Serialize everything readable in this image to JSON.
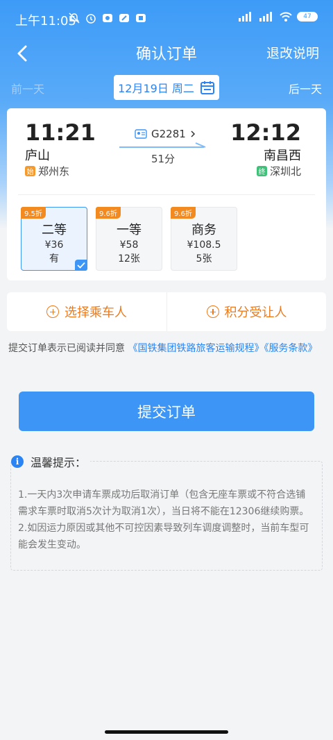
{
  "status_bar": {
    "time": "上午11:05",
    "battery": "47"
  },
  "nav": {
    "title": "确认订单",
    "right_link": "退改说明"
  },
  "date_bar": {
    "prev_day": "前一天",
    "date": "12月19日 周二",
    "next_day": "后一天"
  },
  "train": {
    "depart_time": "11:21",
    "arrive_time": "12:12",
    "depart_station": "庐山",
    "arrive_station": "南昌西",
    "origin_tag": "始",
    "origin": "郑州东",
    "terminal_tag": "终",
    "terminal": "深圳北",
    "train_no": "G2281",
    "duration": "51分"
  },
  "seats": [
    {
      "discount": "9.5折",
      "class": "二等",
      "price": "¥36",
      "availability": "有",
      "selected": true
    },
    {
      "discount": "9.6折",
      "class": "一等",
      "price": "¥58",
      "availability": "12张",
      "selected": false
    },
    {
      "discount": "9.6折",
      "class": "商务",
      "price": "¥108.5",
      "availability": "5张",
      "selected": false
    }
  ],
  "actions": {
    "select_passenger": "选择乘车人",
    "points_beneficiary": "积分受让人"
  },
  "agreement": {
    "prefix": "提交订单表示已阅读并同意",
    "link1": "《国铁集团铁路旅客运输规程》",
    "link2": "《服务条款》"
  },
  "submit_label": "提交订单",
  "tips": {
    "title": "温馨提示：",
    "items": [
      "1.一天内3次申请车票成功后取消订单（包含无座车票或不符合选铺需求车票时取消5次计为取消1次），当日将不能在12306继续购票。",
      "2.如因运力原因或其他不可控因素导致列车调度调整时，当前车型可能会发生变动。"
    ]
  },
  "colors": {
    "primary": "#3d95f5",
    "accent_orange": "#ee7a1a",
    "discount_badge": "#f28a20"
  }
}
